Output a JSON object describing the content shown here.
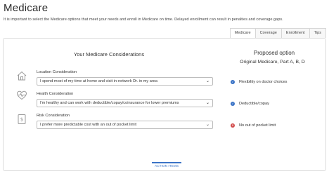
{
  "page": {
    "title": "Medicare",
    "intro": "It is important to select the Medicare options that meet your needs and enroll in Medicare on time. Delayed enrollment can result in penalties and coverage gaps."
  },
  "tabs": [
    {
      "label": "Medicare",
      "active": true
    },
    {
      "label": "Coverage",
      "active": false
    },
    {
      "label": "Enrollment",
      "active": false
    },
    {
      "label": "Tips",
      "active": false
    }
  ],
  "considerations": {
    "heading": "Your Medicare Considerations",
    "rows": [
      {
        "icon": "house-icon",
        "label": "Location Consideration",
        "value": "I spend most of my time at home and visit in-network Dr. in my area"
      },
      {
        "icon": "heartbeat-icon",
        "label": "Health Consideration",
        "value": "I'm healthy and can work with deductible/copay/coinsurance for lower premiums"
      },
      {
        "icon": "dollar-document-icon",
        "label": "Risk Consideration",
        "value": "I prefer more predictable cost with an out of pocket limit"
      }
    ]
  },
  "proposed": {
    "heading": "Proposed option",
    "option": "Original Medicare, Part A, B, D",
    "items": [
      {
        "status": "check",
        "text": "Flexibility on doctor choices"
      },
      {
        "status": "check",
        "text": "Deductible/copay"
      },
      {
        "status": "cross",
        "text": "No out of pocket limit"
      }
    ]
  },
  "action_button": "ACTION ITEMS",
  "colors": {
    "accent": "#3a73c6",
    "negative": "#d24c4c"
  }
}
